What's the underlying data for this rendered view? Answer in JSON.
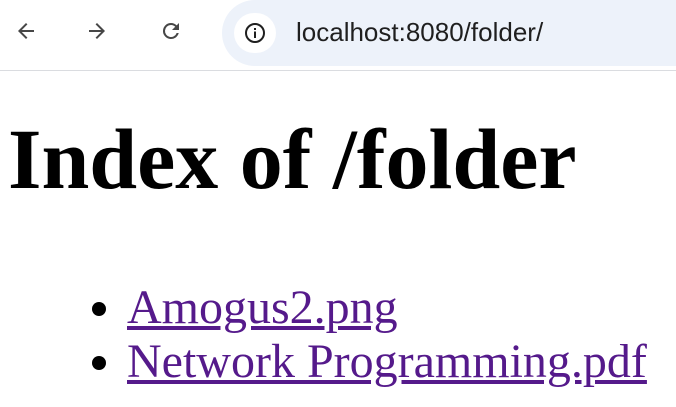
{
  "browser": {
    "url": "localhost:8080/folder/",
    "icons": {
      "back": "arrow-left-icon",
      "forward": "arrow-right-icon",
      "reload": "reload-icon",
      "site_info": "info-icon"
    }
  },
  "page": {
    "heading": "Index of /folder",
    "files": [
      {
        "name": "Amogus2.png"
      },
      {
        "name": "Network Programming.pdf"
      }
    ],
    "link_color": "#551a8b"
  }
}
